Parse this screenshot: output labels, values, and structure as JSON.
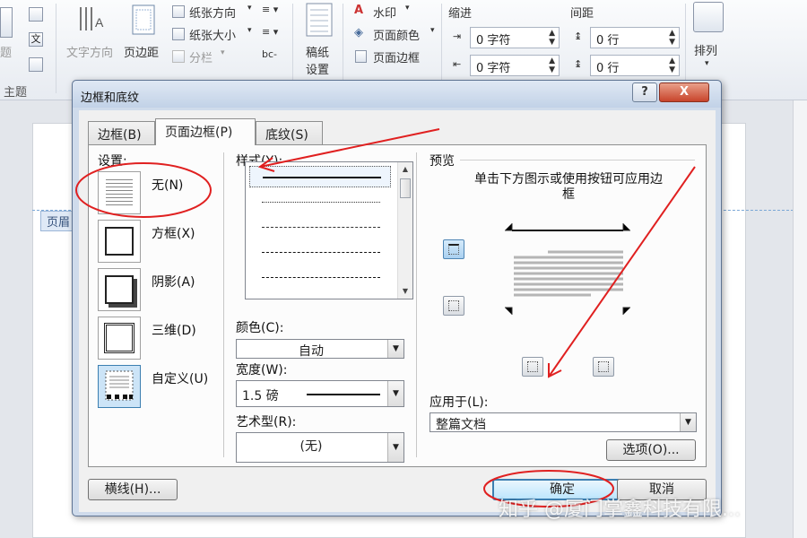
{
  "ribbon": {
    "theme_partial": "题",
    "theme_label": "主题",
    "doc_icon_char": "文",
    "text_direction": "文字方向",
    "margins": "页边距",
    "paper_direction": "纸张方向",
    "paper_size": "纸张大小",
    "columns": "分栏",
    "hyphen_glyph": "bc-",
    "manuscript": "稿纸\n设置",
    "manuscript_l1": "稿纸",
    "manuscript_l2": "设置",
    "watermark": "水印",
    "page_color": "页面颜色",
    "page_border": "页面边框",
    "indent_label": "缩进",
    "indent_left": "0 字符",
    "indent_right": "0 字符",
    "spacing_label": "间距",
    "spacing_before": "0 行",
    "spacing_after": "0 行",
    "arrange": "排列"
  },
  "document": {
    "header_tag": "页眉"
  },
  "dialog": {
    "title": "边框和底纹",
    "help_glyph": "?",
    "close_glyph": "X",
    "tabs": [
      {
        "label": "边框(B)"
      },
      {
        "label": "页面边框(P)"
      },
      {
        "label": "底纹(S)"
      }
    ],
    "settings_label": "设置:",
    "settings": [
      {
        "label": "无(N)"
      },
      {
        "label": "方框(X)"
      },
      {
        "label": "阴影(A)"
      },
      {
        "label": "三维(D)"
      },
      {
        "label": "自定义(U)"
      }
    ],
    "style_label": "样式(Y):",
    "color_label": "颜色(C):",
    "color_value": "自动",
    "width_label": "宽度(W):",
    "width_value": "1.5 磅",
    "art_label": "艺术型(R):",
    "art_value": "(无)",
    "preview_label": "预览",
    "preview_hint": "单击下方图示或使用按钮可应用边框",
    "apply_label": "应用于(L):",
    "apply_value": "整篇文档",
    "options_button": "选项(O)...",
    "horizontal_line_button": "横线(H)...",
    "ok_button": "确定",
    "cancel_button": "取消"
  },
  "watermark_text": "知乎 @厦门掌鑫科技有限...",
  "colors": {
    "annotation_red": "#e02020",
    "dialog_frame": "#cfdbeb",
    "selected_blue": "#3c7fb1"
  }
}
